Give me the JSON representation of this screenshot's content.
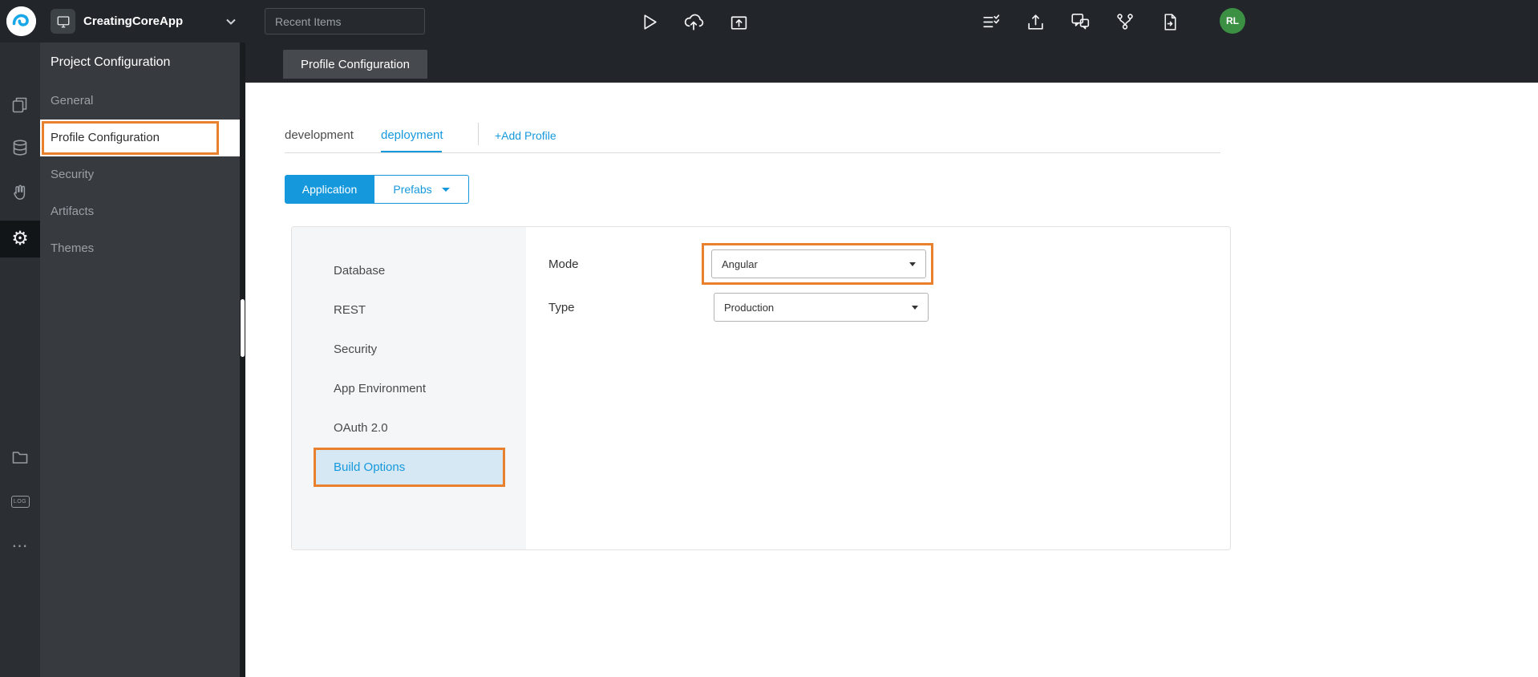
{
  "topbar": {
    "app_name": "CreatingCoreApp",
    "recent_items_placeholder": "Recent Items",
    "avatar_initials": "RL"
  },
  "rail": {
    "log_label": "LOG"
  },
  "sidebar": {
    "title": "Project Configuration",
    "items": [
      {
        "label": "General"
      },
      {
        "label": "Profile Configuration"
      },
      {
        "label": "Security"
      },
      {
        "label": "Artifacts"
      },
      {
        "label": "Themes"
      }
    ]
  },
  "main": {
    "breadcrumb_tab": "Profile Configuration",
    "profile_tabs": {
      "development": "development",
      "deployment": "deployment",
      "add_profile": "+Add Profile"
    },
    "toggle": {
      "application": "Application",
      "prefabs": "Prefabs"
    },
    "panel": {
      "subnav": [
        "Database",
        "REST",
        "Security",
        "App Environment",
        "OAuth 2.0",
        "Build Options"
      ],
      "form": {
        "mode_label": "Mode",
        "mode_value": "Angular",
        "type_label": "Type",
        "type_value": "Production"
      }
    }
  },
  "colors": {
    "accent_blue": "#1699dc",
    "annotation_orange": "#e8802d",
    "avatar_green": "#3c9043",
    "active_subnav_bg": "#d7e8f5"
  }
}
